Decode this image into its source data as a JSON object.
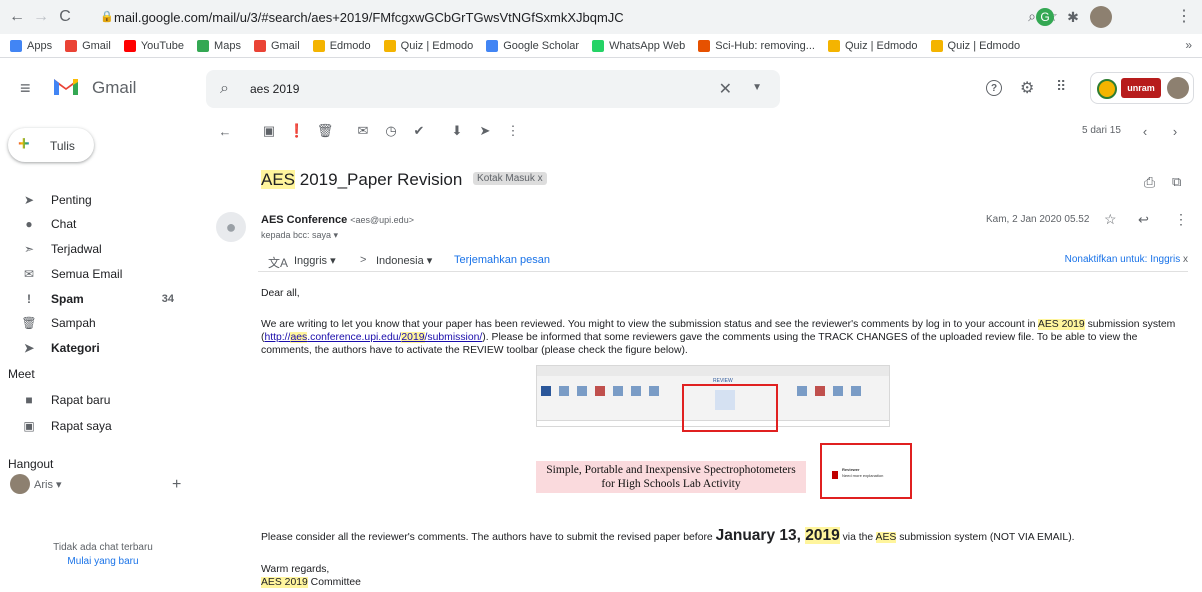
{
  "browser": {
    "url": "mail.google.com/mail/u/3/#search/aes+2019/FMfcgxwGCbGrTGwsVtNGfSxmkXJbqmJC",
    "bookmarks": [
      {
        "label": "Apps",
        "color": "#4285f4"
      },
      {
        "label": "Gmail",
        "color": "#ea4335"
      },
      {
        "label": "YouTube",
        "color": "#ff0000"
      },
      {
        "label": "Maps",
        "color": "#34a853"
      },
      {
        "label": "Gmail",
        "color": "#ea4335"
      },
      {
        "label": "Edmodo",
        "color": "#f4b400"
      },
      {
        "label": "Quiz | Edmodo",
        "color": "#f4b400"
      },
      {
        "label": "Google Scholar",
        "color": "#4285f4"
      },
      {
        "label": "WhatsApp Web",
        "color": "#25d366"
      },
      {
        "label": "Sci-Hub: removing...",
        "color": "#e65100"
      },
      {
        "label": "Quiz | Edmodo",
        "color": "#f4b400"
      },
      {
        "label": "Quiz | Edmodo",
        "color": "#f4b400"
      }
    ],
    "more": "»"
  },
  "gmail": {
    "logo_text": "Gmail",
    "search_query": "aes 2019",
    "compose_label": "Tulis",
    "nav": [
      {
        "label": "Penting",
        "icon": "label-important-icon",
        "glyph": "➤"
      },
      {
        "label": "Chat",
        "icon": "chat-icon",
        "glyph": "●"
      },
      {
        "label": "Terjadwal",
        "icon": "schedule-send-icon",
        "glyph": "➣"
      },
      {
        "label": "Semua Email",
        "icon": "all-mail-icon",
        "glyph": "✉"
      },
      {
        "label": "Spam",
        "icon": "spam-icon",
        "glyph": "!",
        "count": "34"
      },
      {
        "label": "Sampah",
        "icon": "trash-icon",
        "glyph": "🗑"
      },
      {
        "label": "Kategori",
        "icon": "category-icon",
        "glyph": "➤"
      }
    ],
    "meet": {
      "title": "Meet",
      "items": [
        {
          "label": "Rapat baru",
          "icon": "video-camera-icon"
        },
        {
          "label": "Rapat saya",
          "icon": "calendar-icon"
        }
      ]
    },
    "hangout": {
      "title": "Hangout",
      "user": "Aris",
      "no_chat": "Tidak ada chat terbaru",
      "start_new": "Mulai yang baru"
    },
    "pagination": "5 dari 15",
    "logo_badge": "unram mail"
  },
  "email": {
    "subject_hl": "AES",
    "subject_rest": " 2019_Paper Revision",
    "label_chip": "Kotak Masuk",
    "label_x": "x",
    "sender_name": "AES Conference",
    "sender_email": "<aes@upi.edu>",
    "recipients": "kepada bcc: saya",
    "date": "Kam, 2 Jan 2020 05.52",
    "translate": {
      "from": "Inggris",
      "arrow": ">",
      "to": "Indonesia",
      "action": "Terjemahkan pesan",
      "disable": "Nonaktifkan untuk: Inggris",
      "close": "x"
    },
    "greeting": "Dear all,",
    "p1_a": "We are writing to let you know that your paper has been reviewed. You might to view the submission status and see the reviewer's comments by log in to your account in ",
    "p1_hl1": "AES 2019",
    "p1_b": " submission system (",
    "p1_link_a": "http://",
    "p1_link_hl": "aes",
    "p1_link_b": ".conference.upi.edu/",
    "p1_link_hl2": "2019",
    "p1_link_c": "/submission/",
    "p1_c": "). Please be informed that some reviewers gave the comments using the TRACK CHANGES of the uploaded review file. To be able to view the comments, the authors have to activate the REVIEW toolbar (please check the figure below).",
    "figure_title_1": "Simple, Portable and Inexpensive Spectrophotometers",
    "figure_title_2": "for High Schools Lab Activity",
    "figure_ribbon_tab": "REVIEW",
    "figure_ribbon_btn": "Track Changes",
    "figure_comment_author": "Reviewer",
    "figure_comment_text": "Need more explanation",
    "p2_a": "Please consider all the reviewer's comments. The authors have to submit the revised paper before ",
    "p2_date_a": "January 13, ",
    "p2_date_hl": "2019",
    "p2_b": " via the ",
    "p2_hl": "AES",
    "p2_c": " submission system (NOT VIA EMAIL).",
    "closing": "Warm regards,",
    "sign_hl": "AES 2019",
    "sign_rest": " Committee"
  }
}
